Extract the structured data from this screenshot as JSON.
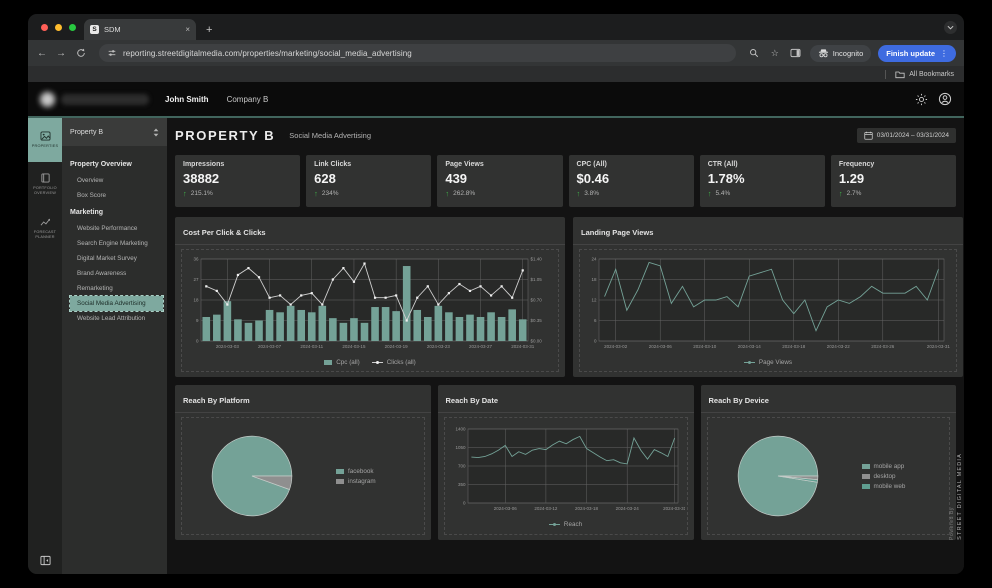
{
  "icons": {
    "back": "←",
    "forward": "→",
    "close": "×",
    "new_tab": "+",
    "kebab": "⋮",
    "star": "☆",
    "up_arrow": "↑"
  },
  "browser": {
    "tab_title": "SDM",
    "favicon_letter": "S",
    "url": "reporting.streetdigitalmedia.com/properties/marketing/social_media_advertising",
    "incognito_label": "Incognito",
    "update_button": "Finish update",
    "bookmarks_label": "All Bookmarks"
  },
  "header": {
    "user_name": "John Smith",
    "company": "Company B"
  },
  "rail": {
    "items": [
      {
        "label": "PROPERTIES",
        "active": true
      },
      {
        "label": "PORTFOLIO OVERVIEW",
        "active": false
      },
      {
        "label": "FORECAST PLANNER",
        "active": false
      }
    ]
  },
  "sidebar": {
    "property_select": "Property B",
    "sections": [
      {
        "title": "Property Overview",
        "items": [
          "Overview",
          "Box Score"
        ]
      },
      {
        "title": "Marketing",
        "items": [
          "Website Performance",
          "Search Engine Marketing",
          "Digital Market Survey",
          "Brand Awareness",
          "Remarketing",
          "Social Media Advertising",
          "Website Lead Attribution"
        ],
        "active_item": "Social Media Advertising"
      }
    ]
  },
  "page": {
    "title": "PROPERTY B",
    "subtitle": "Social Media Advertising",
    "date_range": "03/01/2024 – 03/31/2024",
    "powered_by": "Powered By",
    "brand_vertical": "STREET DIGITAL MEDIA"
  },
  "kpis": [
    {
      "label": "Impressions",
      "value": "38882",
      "delta": "215.1%"
    },
    {
      "label": "Link Clicks",
      "value": "628",
      "delta": "234%"
    },
    {
      "label": "Page Views",
      "value": "439",
      "delta": "262.8%"
    },
    {
      "label": "CPC (All)",
      "value": "$0.46",
      "delta": "3.8%"
    },
    {
      "label": "CTR (All)",
      "value": "1.78%",
      "delta": "5.4%"
    },
    {
      "label": "Frequency",
      "value": "1.29",
      "delta": "2.7%"
    }
  ],
  "colors": {
    "accent_teal": "#74a297",
    "line_gray": "#cfcfcf",
    "marker_white": "#efefef",
    "grid": "#646464",
    "plot_bg": "#282928",
    "axis_text": "#9a9a9a",
    "pie_gray": "#8f8f8f",
    "pie_teal2": "#5f9e90",
    "kpi_green": "#3fae49",
    "update_blue": "#3e6be0",
    "teal_divider": "#41655d"
  },
  "chart_data": [
    {
      "id": "cpc_clicks",
      "type": "combo",
      "title": "Cost Per Click & Clicks",
      "x": [
        "2024-03-01",
        "2024-03-02",
        "2024-03-03",
        "2024-03-04",
        "2024-03-05",
        "2024-03-06",
        "2024-03-07",
        "2024-03-08",
        "2024-03-09",
        "2024-03-10",
        "2024-03-11",
        "2024-03-12",
        "2024-03-13",
        "2024-03-14",
        "2024-03-15",
        "2024-03-16",
        "2024-03-17",
        "2024-03-18",
        "2024-03-19",
        "2024-03-20",
        "2024-03-21",
        "2024-03-22",
        "2024-03-23",
        "2024-03-24",
        "2024-03-25",
        "2024-03-26",
        "2024-03-27",
        "2024-03-28",
        "2024-03-29",
        "2024-03-30",
        "2024-03-31"
      ],
      "xtick_indices": [
        2,
        6,
        10,
        14,
        18,
        22,
        26,
        30
      ],
      "left_axis": {
        "lim": [
          0,
          36
        ],
        "ticks": [
          0,
          9,
          18,
          27,
          36
        ]
      },
      "right_axis": {
        "lim": [
          0,
          1.4
        ],
        "ticks": [
          "$0.00",
          "$0.35",
          "$0.70",
          "$1.05",
          "$1.40"
        ]
      },
      "legend_position": "bottom",
      "grid": true,
      "series": [
        {
          "name": "Cpc (all)",
          "type": "bar",
          "axis": "right",
          "values": [
            0.41,
            0.45,
            0.68,
            0.37,
            0.31,
            0.35,
            0.53,
            0.49,
            0.6,
            0.53,
            0.49,
            0.6,
            0.39,
            0.31,
            0.39,
            0.31,
            0.58,
            0.58,
            0.51,
            1.28,
            0.53,
            0.41,
            0.6,
            0.49,
            0.41,
            0.45,
            0.41,
            0.49,
            0.41,
            0.54,
            0.37
          ]
        },
        {
          "name": "Clicks (all)",
          "type": "line",
          "axis": "left",
          "markers": true,
          "values": [
            24,
            22,
            16,
            29,
            32,
            28,
            19,
            20,
            16,
            20,
            21,
            16,
            27,
            32,
            26,
            34,
            19,
            19,
            20,
            9,
            19,
            24,
            16,
            21,
            25,
            22,
            24,
            20,
            24,
            19,
            31
          ]
        }
      ]
    },
    {
      "id": "landing_page_views",
      "type": "line",
      "title": "Landing Page Views",
      "x": [
        "2024-03-01",
        "2024-03-02",
        "2024-03-03",
        "2024-03-04",
        "2024-03-05",
        "2024-03-06",
        "2024-03-07",
        "2024-03-08",
        "2024-03-09",
        "2024-03-10",
        "2024-03-11",
        "2024-03-12",
        "2024-03-13",
        "2024-03-14",
        "2024-03-15",
        "2024-03-16",
        "2024-03-17",
        "2024-03-18",
        "2024-03-19",
        "2024-03-20",
        "2024-03-21",
        "2024-03-22",
        "2024-03-23",
        "2024-03-24",
        "2024-03-25",
        "2024-03-26",
        "2024-03-27",
        "2024-03-28",
        "2024-03-29",
        "2024-03-30",
        "2024-03-31"
      ],
      "xtick_indices": [
        1,
        5,
        9,
        13,
        17,
        21,
        25,
        30
      ],
      "left_axis": {
        "lim": [
          0,
          24
        ],
        "ticks": [
          0,
          6,
          12,
          18,
          24
        ]
      },
      "legend_position": "bottom",
      "grid": true,
      "series": [
        {
          "name": "Page Views",
          "type": "line",
          "axis": "left",
          "markers": false,
          "values": [
            13,
            21,
            9,
            15,
            23,
            22,
            11,
            16,
            10,
            12,
            12,
            13,
            10,
            19,
            20,
            21,
            12,
            8,
            12,
            3,
            10,
            12,
            11,
            13,
            16,
            14,
            14,
            14,
            16,
            12,
            21
          ]
        }
      ]
    },
    {
      "id": "reach_by_platform",
      "type": "pie",
      "title": "Reach By Platform",
      "start_angle": 19.8,
      "legend_position": "right",
      "slices": [
        {
          "label": "facebook",
          "value": 94.5
        },
        {
          "label": "instagram",
          "value": 5.5
        }
      ]
    },
    {
      "id": "reach_by_date",
      "type": "line",
      "title": "Reach By Date",
      "x": [
        "2024-03-01",
        "2024-03-02",
        "2024-03-03",
        "2024-03-04",
        "2024-03-05",
        "2024-03-06",
        "2024-03-07",
        "2024-03-08",
        "2024-03-09",
        "2024-03-10",
        "2024-03-11",
        "2024-03-12",
        "2024-03-13",
        "2024-03-14",
        "2024-03-15",
        "2024-03-16",
        "2024-03-17",
        "2024-03-18",
        "2024-03-19",
        "2024-03-20",
        "2024-03-21",
        "2024-03-22",
        "2024-03-23",
        "2024-03-24",
        "2024-03-25",
        "2024-03-26",
        "2024-03-27",
        "2024-03-28",
        "2024-03-29",
        "2024-03-30",
        "2024-03-31"
      ],
      "xtick_indices": [
        5,
        11,
        17,
        23,
        30
      ],
      "left_axis": {
        "lim": [
          0,
          1400
        ],
        "ticks": [
          0,
          350,
          700,
          1050,
          1400
        ]
      },
      "legend_position": "bottom",
      "grid": true,
      "series": [
        {
          "name": "Reach",
          "type": "line",
          "axis": "left",
          "markers": false,
          "values": [
            870,
            860,
            880,
            930,
            1000,
            1090,
            880,
            970,
            920,
            1000,
            1030,
            1010,
            1100,
            1170,
            1120,
            1200,
            1260,
            1030,
            950,
            870,
            800,
            820,
            760,
            740,
            1230,
            1000,
            830,
            1010,
            950,
            880,
            1230
          ]
        }
      ]
    },
    {
      "id": "reach_by_device",
      "type": "pie",
      "title": "Reach By Device",
      "start_angle": 9,
      "legend_position": "right",
      "slices": [
        {
          "label": "mobile app",
          "value": 97.5
        },
        {
          "label": "desktop",
          "value": 1.5
        },
        {
          "label": "mobile web",
          "value": 1.0
        }
      ]
    }
  ]
}
